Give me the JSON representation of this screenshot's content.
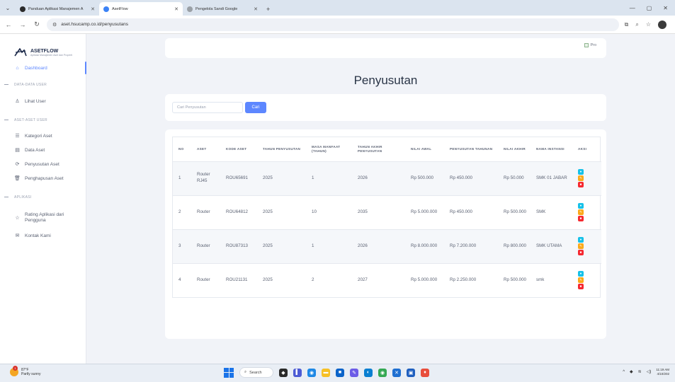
{
  "browser": {
    "tabs": [
      {
        "label": "Panduan Aplikasi Manajemen A",
        "close": "✕",
        "favicon_color": "#2b2b2b"
      },
      {
        "label": "AsetFlow",
        "close": "✕",
        "favicon_color": "#3b82f6"
      },
      {
        "label": "Pengelola Sandi Google",
        "close": "✕",
        "favicon_color": "#9aa0a6"
      }
    ],
    "new_tab": "+",
    "url": "aset.hsucamp.co.id/penyusutans"
  },
  "brand": {
    "name": "ASETFLOW",
    "tagline": "Aplikasi Manajemen Aset dan Properti"
  },
  "sidebar": {
    "dashboard": "Dashboard",
    "section_data_user": "DATA-DATA USER",
    "lihat_user": "Lihat User",
    "section_aset_user": "ASET-ASET USER",
    "kategori_aset": "Kategori Aset",
    "data_aset": "Data Aset",
    "penyusutan_aset": "Penyusutan Aset",
    "penghapusan_aset": "Penghapusan Aset",
    "section_aplikasi": "APLIKASI",
    "rating": "Rating Aplikasi dari Pengguna",
    "kontak": "Kontak Kami"
  },
  "topbar": {
    "profile_alt": "Pro"
  },
  "page_title": "Penyusutan",
  "search": {
    "placeholder": "Cari Penyusutan",
    "button": "Cari"
  },
  "table": {
    "headers": {
      "no": "NO",
      "aset": "ASET",
      "kode": "KODE ASET",
      "tahun": "TAHUN PENYUSUTAN",
      "masa": "MASA MANFAAT (TAHUN)",
      "akhir": "TAHUN AKHIR PENYUSUTAN",
      "nilai_awal": "NILAI AWAL",
      "penyusutan": "PENYUSUTAN TAHUNAN",
      "nilai_akhir": "NILAI AKHIR",
      "instansi": "NAMA INSTANSI",
      "aksi": "AKSI"
    },
    "rows": [
      {
        "no": "1",
        "aset": "Router RJ45",
        "kode": "ROU65691",
        "tahun": "2025",
        "masa": "1",
        "akhir": "2026",
        "nilai_awal": "Rp 500.000",
        "penyusutan": "Rp 450.000",
        "nilai_akhir": "Rp 50.000",
        "instansi": "SMK 01 JABAR"
      },
      {
        "no": "2",
        "aset": "Router",
        "kode": "ROU64812",
        "tahun": "2025",
        "masa": "10",
        "akhir": "2035",
        "nilai_awal": "Rp 5.000.000",
        "penyusutan": "Rp 450.000",
        "nilai_akhir": "Rp 500.000",
        "instansi": "SMK"
      },
      {
        "no": "3",
        "aset": "Router",
        "kode": "ROU87313",
        "tahun": "2025",
        "masa": "1",
        "akhir": "2026",
        "nilai_awal": "Rp 8.000.000",
        "penyusutan": "Rp 7.200.000",
        "nilai_akhir": "Rp 800.000",
        "instansi": "SMK UTAMA"
      },
      {
        "no": "4",
        "aset": "Router",
        "kode": "ROU21131",
        "tahun": "2025",
        "masa": "2",
        "akhir": "2027",
        "nilai_awal": "Rp 5.000.000",
        "penyusutan": "Rp 2.250.000",
        "nilai_akhir": "Rp 500.000",
        "instansi": "smk"
      }
    ]
  },
  "taskbar": {
    "weather_temp": "87°F",
    "weather_desc": "Partly sunny",
    "weather_badge": "1",
    "search_label": "Search",
    "time": "11:19 AM",
    "date": "4/10/202"
  },
  "colors": {
    "accent": "#5d87ff",
    "view": "#17c1e8",
    "edit": "#fba919",
    "delete": "#f5282f"
  }
}
